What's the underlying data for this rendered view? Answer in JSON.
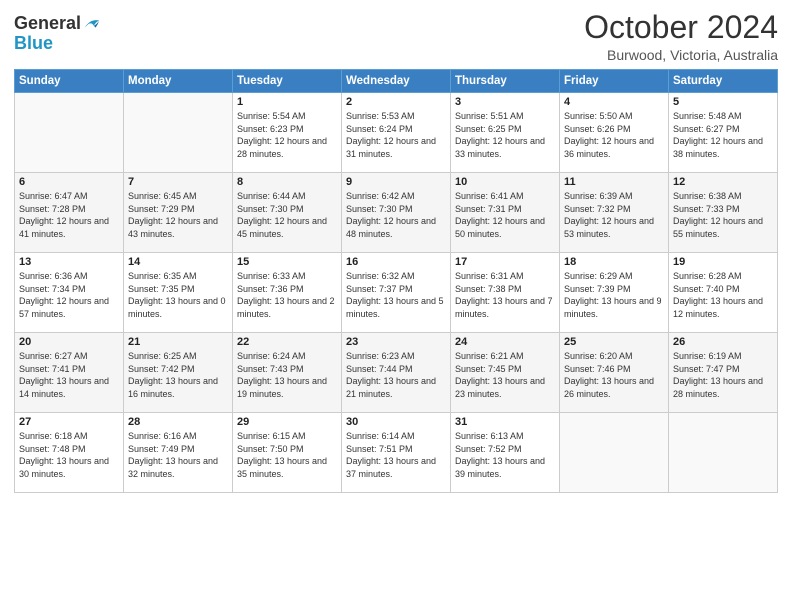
{
  "logo": {
    "line1": "General",
    "line2": "Blue"
  },
  "title": "October 2024",
  "subtitle": "Burwood, Victoria, Australia",
  "days_of_week": [
    "Sunday",
    "Monday",
    "Tuesday",
    "Wednesday",
    "Thursday",
    "Friday",
    "Saturday"
  ],
  "weeks": [
    [
      {
        "day": "",
        "info": ""
      },
      {
        "day": "",
        "info": ""
      },
      {
        "day": "1",
        "info": "Sunrise: 5:54 AM\nSunset: 6:23 PM\nDaylight: 12 hours and 28 minutes."
      },
      {
        "day": "2",
        "info": "Sunrise: 5:53 AM\nSunset: 6:24 PM\nDaylight: 12 hours and 31 minutes."
      },
      {
        "day": "3",
        "info": "Sunrise: 5:51 AM\nSunset: 6:25 PM\nDaylight: 12 hours and 33 minutes."
      },
      {
        "day": "4",
        "info": "Sunrise: 5:50 AM\nSunset: 6:26 PM\nDaylight: 12 hours and 36 minutes."
      },
      {
        "day": "5",
        "info": "Sunrise: 5:48 AM\nSunset: 6:27 PM\nDaylight: 12 hours and 38 minutes."
      }
    ],
    [
      {
        "day": "6",
        "info": "Sunrise: 6:47 AM\nSunset: 7:28 PM\nDaylight: 12 hours and 41 minutes."
      },
      {
        "day": "7",
        "info": "Sunrise: 6:45 AM\nSunset: 7:29 PM\nDaylight: 12 hours and 43 minutes."
      },
      {
        "day": "8",
        "info": "Sunrise: 6:44 AM\nSunset: 7:30 PM\nDaylight: 12 hours and 45 minutes."
      },
      {
        "day": "9",
        "info": "Sunrise: 6:42 AM\nSunset: 7:30 PM\nDaylight: 12 hours and 48 minutes."
      },
      {
        "day": "10",
        "info": "Sunrise: 6:41 AM\nSunset: 7:31 PM\nDaylight: 12 hours and 50 minutes."
      },
      {
        "day": "11",
        "info": "Sunrise: 6:39 AM\nSunset: 7:32 PM\nDaylight: 12 hours and 53 minutes."
      },
      {
        "day": "12",
        "info": "Sunrise: 6:38 AM\nSunset: 7:33 PM\nDaylight: 12 hours and 55 minutes."
      }
    ],
    [
      {
        "day": "13",
        "info": "Sunrise: 6:36 AM\nSunset: 7:34 PM\nDaylight: 12 hours and 57 minutes."
      },
      {
        "day": "14",
        "info": "Sunrise: 6:35 AM\nSunset: 7:35 PM\nDaylight: 13 hours and 0 minutes."
      },
      {
        "day": "15",
        "info": "Sunrise: 6:33 AM\nSunset: 7:36 PM\nDaylight: 13 hours and 2 minutes."
      },
      {
        "day": "16",
        "info": "Sunrise: 6:32 AM\nSunset: 7:37 PM\nDaylight: 13 hours and 5 minutes."
      },
      {
        "day": "17",
        "info": "Sunrise: 6:31 AM\nSunset: 7:38 PM\nDaylight: 13 hours and 7 minutes."
      },
      {
        "day": "18",
        "info": "Sunrise: 6:29 AM\nSunset: 7:39 PM\nDaylight: 13 hours and 9 minutes."
      },
      {
        "day": "19",
        "info": "Sunrise: 6:28 AM\nSunset: 7:40 PM\nDaylight: 13 hours and 12 minutes."
      }
    ],
    [
      {
        "day": "20",
        "info": "Sunrise: 6:27 AM\nSunset: 7:41 PM\nDaylight: 13 hours and 14 minutes."
      },
      {
        "day": "21",
        "info": "Sunrise: 6:25 AM\nSunset: 7:42 PM\nDaylight: 13 hours and 16 minutes."
      },
      {
        "day": "22",
        "info": "Sunrise: 6:24 AM\nSunset: 7:43 PM\nDaylight: 13 hours and 19 minutes."
      },
      {
        "day": "23",
        "info": "Sunrise: 6:23 AM\nSunset: 7:44 PM\nDaylight: 13 hours and 21 minutes."
      },
      {
        "day": "24",
        "info": "Sunrise: 6:21 AM\nSunset: 7:45 PM\nDaylight: 13 hours and 23 minutes."
      },
      {
        "day": "25",
        "info": "Sunrise: 6:20 AM\nSunset: 7:46 PM\nDaylight: 13 hours and 26 minutes."
      },
      {
        "day": "26",
        "info": "Sunrise: 6:19 AM\nSunset: 7:47 PM\nDaylight: 13 hours and 28 minutes."
      }
    ],
    [
      {
        "day": "27",
        "info": "Sunrise: 6:18 AM\nSunset: 7:48 PM\nDaylight: 13 hours and 30 minutes."
      },
      {
        "day": "28",
        "info": "Sunrise: 6:16 AM\nSunset: 7:49 PM\nDaylight: 13 hours and 32 minutes."
      },
      {
        "day": "29",
        "info": "Sunrise: 6:15 AM\nSunset: 7:50 PM\nDaylight: 13 hours and 35 minutes."
      },
      {
        "day": "30",
        "info": "Sunrise: 6:14 AM\nSunset: 7:51 PM\nDaylight: 13 hours and 37 minutes."
      },
      {
        "day": "31",
        "info": "Sunrise: 6:13 AM\nSunset: 7:52 PM\nDaylight: 13 hours and 39 minutes."
      },
      {
        "day": "",
        "info": ""
      },
      {
        "day": "",
        "info": ""
      }
    ]
  ]
}
